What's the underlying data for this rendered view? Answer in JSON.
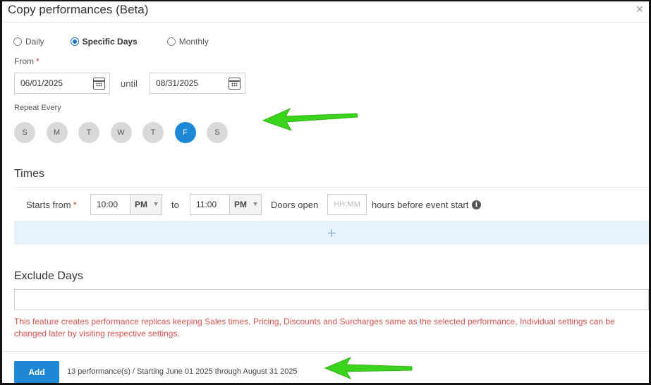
{
  "dialog": {
    "title": "Copy performances (Beta)",
    "close_glyph": "×"
  },
  "recurrence": {
    "options": [
      {
        "label": "Daily",
        "checked": false
      },
      {
        "label": "Specific Days",
        "checked": true
      },
      {
        "label": "Monthly",
        "checked": false
      }
    ]
  },
  "range": {
    "from_label": "From",
    "required_mark": "*",
    "from_value": "06/01/2025",
    "until_label": "until",
    "until_value": "08/31/2025"
  },
  "repeat": {
    "label": "Repeat Every",
    "days": [
      {
        "label": "S",
        "active": false
      },
      {
        "label": "M",
        "active": false
      },
      {
        "label": "T",
        "active": false
      },
      {
        "label": "W",
        "active": false
      },
      {
        "label": "T",
        "active": false
      },
      {
        "label": "F",
        "active": true
      },
      {
        "label": "S",
        "active": false
      }
    ]
  },
  "times": {
    "title": "Times",
    "starts_from_label": "Starts from",
    "start_time": "10:00",
    "start_ampm": "PM",
    "to_label": "to",
    "end_time": "11:00",
    "end_ampm": "PM",
    "doors_open_label": "Doors open",
    "doors_placeholder": "HH:MM",
    "hours_before_label": "hours before event start",
    "info_glyph": "i",
    "add_glyph": "+"
  },
  "exclude": {
    "title": "Exclude Days",
    "value": ""
  },
  "notice": "This feature creates performance replicas keeping Sales times, Pricing, Discounts and Surcharges same as the selected performance, Individual settings can be changed later by visiting respective settings.",
  "footer": {
    "add_label": "Add",
    "summary": "13 performance(s) / Starting June 01 2025 through August 31 2025"
  },
  "colors": {
    "accent": "#1e88d8",
    "annotation_arrow": "#3bd41c",
    "error_text": "#d9534f"
  },
  "icons": [
    "close-icon",
    "calendar-icon",
    "chevron-down-icon",
    "info-icon",
    "plus-icon",
    "arrow-annotation-icon"
  ]
}
